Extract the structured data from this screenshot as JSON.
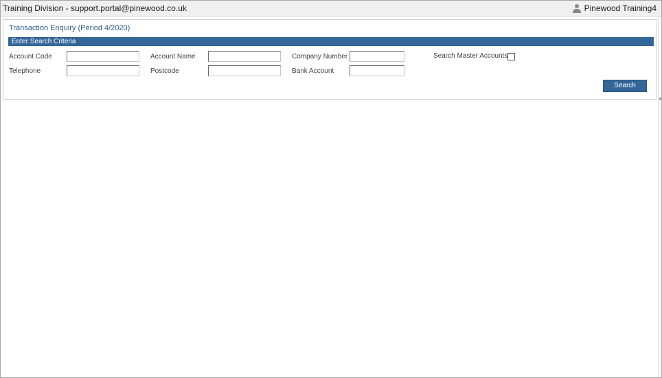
{
  "header": {
    "title": "Training Division - support.portal@pinewood.co.uk",
    "user_name": "Pinewood Training4",
    "user_icon": "user-icon"
  },
  "panel": {
    "title": "Transaction Enquiry (Period 4/2020)",
    "section_heading": "Enter Search Criteria"
  },
  "fields": {
    "account_code": {
      "label": "Account Code",
      "value": ""
    },
    "account_name": {
      "label": "Account Name",
      "value": ""
    },
    "company_number": {
      "label": "Company Number",
      "value": ""
    },
    "search_master_accounts": {
      "label": "Search Master Accounts",
      "checked": false
    },
    "telephone": {
      "label": "Telephone",
      "value": ""
    },
    "postcode": {
      "label": "Postcode",
      "value": ""
    },
    "bank_account": {
      "label": "Bank Account",
      "value": ""
    }
  },
  "actions": {
    "search_label": "Search"
  },
  "colors": {
    "accent": "#336699",
    "title_text": "#2a5b8a"
  }
}
